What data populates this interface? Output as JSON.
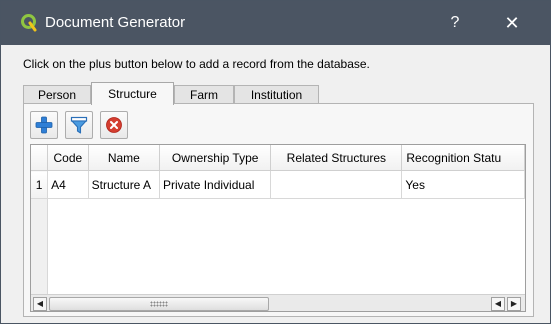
{
  "window": {
    "title": "Document Generator",
    "help_glyph": "?",
    "close_glyph": "✕"
  },
  "instruction": "Click on the plus button below to add a record from the database.",
  "tabs": [
    {
      "label": "Person",
      "active": false
    },
    {
      "label": "Structure",
      "active": true
    },
    {
      "label": "Farm",
      "active": false
    },
    {
      "label": "Institution",
      "active": false
    }
  ],
  "toolbar": {
    "add_icon": "plus-icon",
    "filter_icon": "filter-icon",
    "remove_icon": "remove-icon"
  },
  "table": {
    "columns": [
      "Code",
      "Name",
      "Ownership Type",
      "Related Structures",
      "Recognition Statu"
    ],
    "rows": [
      {
        "row_number": "1",
        "cells": [
          "A4",
          "Structure A",
          "Private Individual",
          "",
          "Yes"
        ]
      }
    ]
  },
  "scrollbar": {
    "left_arrow": "◀",
    "right_arrow": "▶"
  },
  "colors": {
    "titlebar": "#4b5563",
    "add_blue": "#2f7fd6",
    "remove_red": "#d43d2f"
  }
}
